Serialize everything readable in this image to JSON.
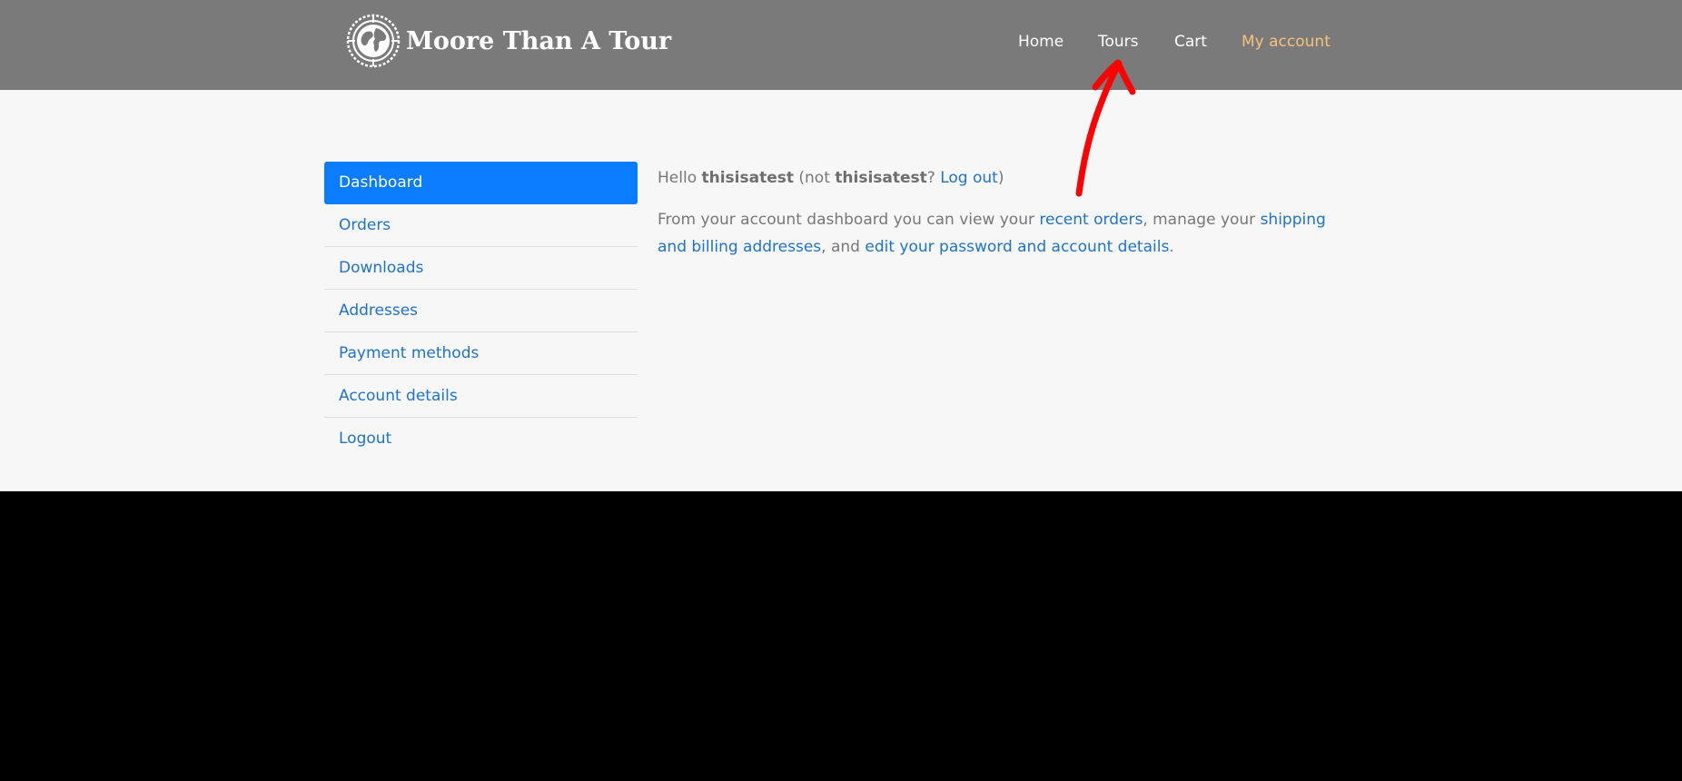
{
  "brand": {
    "name": "Moore Than A Tour"
  },
  "nav": {
    "items": [
      {
        "label": "Home"
      },
      {
        "label": "Tours"
      },
      {
        "label": "Cart"
      },
      {
        "label": "My account"
      }
    ],
    "active_color": "#f5c27a"
  },
  "sidebar": {
    "items": [
      {
        "label": "Dashboard"
      },
      {
        "label": "Orders"
      },
      {
        "label": "Downloads"
      },
      {
        "label": "Addresses"
      },
      {
        "label": "Payment methods"
      },
      {
        "label": "Account details"
      },
      {
        "label": "Logout"
      }
    ],
    "active_color": "#0a7cff"
  },
  "dashboard": {
    "hello_prefix": "Hello ",
    "username": "thisisatest",
    "not_prefix": " (not ",
    "username_repeat": "thisisatest",
    "question": "? ",
    "logout_link": "Log out",
    "close_paren": ")",
    "intro_1": "From your account dashboard you can view your ",
    "recent_orders_link": "recent orders",
    "intro_2": ", manage your ",
    "addresses_link": "shipping and billing addresses",
    "intro_3": ", and ",
    "account_link": "edit your password and account details",
    "intro_4": "."
  },
  "colors": {
    "header_bg": "#7a7a7a",
    "content_bg": "#f7f7f7",
    "link": "#1f73c8",
    "annotation": "#ff0000"
  },
  "icons": {
    "logo": "globe-compass-icon",
    "annotation": "red-arrow-icon"
  }
}
